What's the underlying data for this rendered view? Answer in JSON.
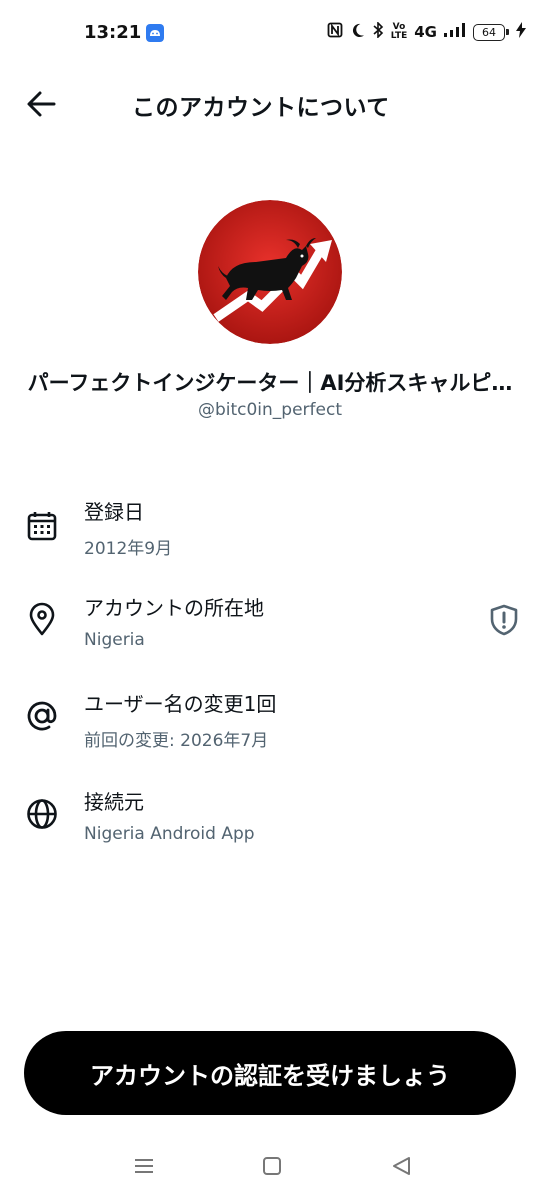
{
  "status_bar": {
    "time": "13:21",
    "volte_top": "Vo",
    "volte_bottom": "LTE",
    "network": "4G",
    "battery": "64"
  },
  "header": {
    "title": "このアカウントについて",
    "back_icon": "arrow-left-icon"
  },
  "profile": {
    "display_name": "パーフェクトインジケーター｜AI分析スキャルピ…",
    "handle": "@bitc0in_perfect"
  },
  "info": [
    {
      "icon": "calendar-icon",
      "label": "登録日",
      "value": "2012年9月"
    },
    {
      "icon": "location-pin-icon",
      "label": "アカウントの所在地",
      "value": "Nigeria",
      "trailing_icon": "shield-alert-icon"
    },
    {
      "icon": "at-sign-icon",
      "label": "ユーザー名の変更1回",
      "value": "前回の変更: 2026年7月"
    },
    {
      "icon": "globe-icon",
      "label": "接続元",
      "value": "Nigeria Android App"
    }
  ],
  "cta": {
    "label": "アカウントの認証を受けましょう"
  },
  "colors": {
    "primary_text": "#0f1419",
    "secondary_text": "#536471",
    "cta_bg": "#000000",
    "avatar_red": "#d0201c"
  }
}
